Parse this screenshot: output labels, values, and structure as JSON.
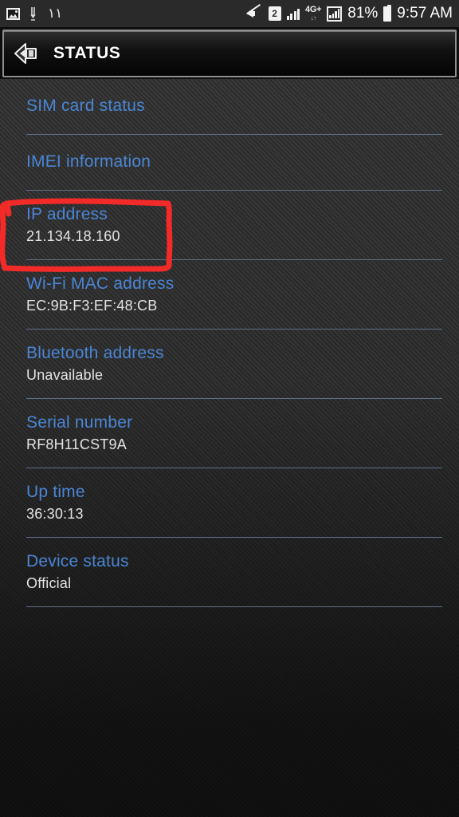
{
  "statusbar": {
    "left_icons": [
      {
        "name": "image-icon",
        "glyph": "picture"
      },
      {
        "name": "download-icon",
        "glyph": "download-arrow"
      },
      {
        "name": "arabic-numeral-indicator",
        "text": "١١"
      }
    ],
    "right_icons": [
      {
        "name": "mute-icon",
        "glyph": "speaker-muted"
      },
      {
        "name": "sim-2-icon",
        "text": "2"
      },
      {
        "name": "signal-bars-icon",
        "glyph": "signal"
      },
      {
        "name": "network-type-icon",
        "label": "4G",
        "plus": "+",
        "arrows": "↓↑"
      },
      {
        "name": "signal-boxed-icon",
        "glyph": "signal-boxed"
      }
    ],
    "battery_percent": "81%",
    "battery_icon": "battery-icon",
    "clock": "9:57 AM"
  },
  "titlebar": {
    "back_icon": "back-arrow-icon",
    "title": "STATUS"
  },
  "colors": {
    "label_blue": "#4a86d4",
    "value_gray": "#e3e3e3",
    "divider": "#5d7188",
    "annotation_red": "#f22b28"
  },
  "list": [
    {
      "label": "SIM card status",
      "value": ""
    },
    {
      "label": "IMEI information",
      "value": ""
    },
    {
      "label": "IP address",
      "value": "21.134.18.160",
      "highlighted": true
    },
    {
      "label": "Wi-Fi MAC address",
      "value": "EC:9B:F3:EF:48:CB"
    },
    {
      "label": "Bluetooth address",
      "value": "Unavailable"
    },
    {
      "label": "Serial number",
      "value": "RF8H11CST9A"
    },
    {
      "label": "Up time",
      "value": "36:30:13"
    },
    {
      "label": "Device status",
      "value": "Official"
    }
  ],
  "annotation": {
    "name": "red-highlight-box",
    "target": "IP address"
  }
}
